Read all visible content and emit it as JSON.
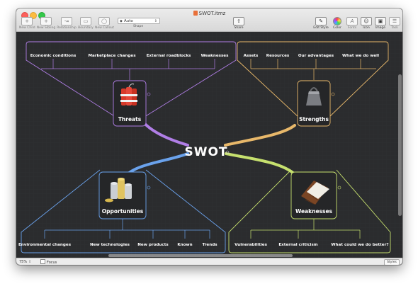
{
  "window": {
    "title": "SWOT.itmz"
  },
  "toolbar": {
    "new_child": "New Child",
    "new_sibling": "New Sibling",
    "relationship": "Relationship",
    "boundary": "Boundary",
    "new_callout": "New Callout",
    "shape_value": "Auto",
    "shape_label": "Shape",
    "share": "Share",
    "edit_style": "Edit Style",
    "color": "Color",
    "fonts": "Fonts",
    "icon": "Icon",
    "image": "Image",
    "task": "Task"
  },
  "map": {
    "central": "SWOT",
    "threats": {
      "label": "Threats",
      "color": "#b07ee6",
      "children": [
        "Economic conditions",
        "Marketplace changes",
        "External roadblocks",
        "Weaknesses"
      ]
    },
    "strengths": {
      "label": "Strengths",
      "color": "#e8b86a",
      "children": [
        "Assets",
        "Resources",
        "Our advantages",
        "What we do well"
      ]
    },
    "opportunities": {
      "label": "Opportunities",
      "color": "#6aa2ec",
      "children": [
        "Environmental changes",
        "New technologies",
        "New products",
        "Known",
        "Trends"
      ]
    },
    "weaknesses": {
      "label": "Weaknesses",
      "color": "#c6e06e",
      "children": [
        "Vulnerabilities",
        "External criticism",
        "What could we do better?"
      ]
    }
  },
  "statusbar": {
    "zoom": "75%",
    "focus": "Focus",
    "styles": "Styles"
  }
}
